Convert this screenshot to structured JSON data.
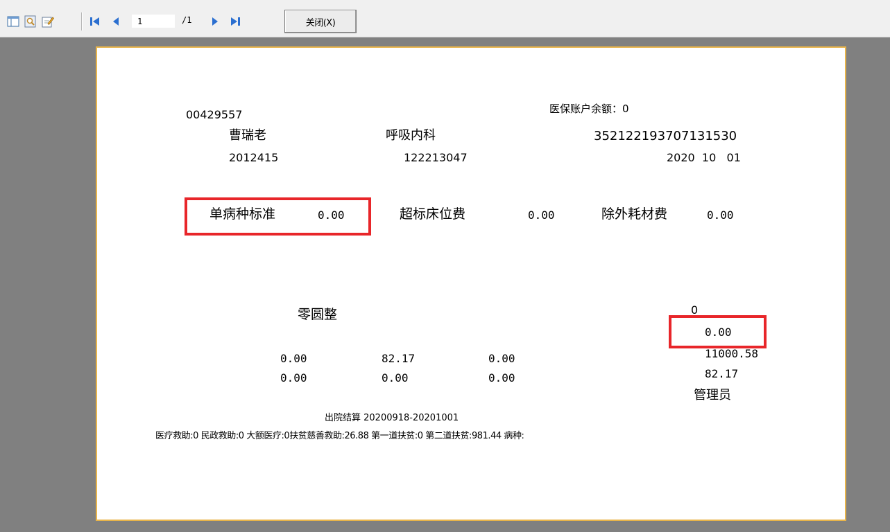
{
  "toolbar": {
    "page_current": "1",
    "page_total": "/1",
    "close_label": "关闭(X)"
  },
  "report": {
    "patient_id": "00429557",
    "account_balance": "医保账户余额：0",
    "name": "曹瑞老",
    "department": "呼吸内科",
    "id_number": "352122193707131530",
    "admission_no": "2012415",
    "insurance_no": "122213047",
    "date": "2020  10   01",
    "fees": {
      "single_disease_label": "单病种标准",
      "single_disease_value": "0.00",
      "over_bed_label": "超标床位费",
      "over_bed_value": "0.00",
      "excluded_material_label": "除外耗材费",
      "excluded_material_value": "0.00"
    },
    "amount_in_words": "零圆整",
    "right_values": [
      "0",
      "0.00",
      "11000.58",
      "82.17"
    ],
    "row1": [
      "0.00",
      "82.17",
      "0.00"
    ],
    "row2": [
      "0.00",
      "0.00",
      "0.00"
    ],
    "operator": "管理员",
    "settlement": "出院结算 20200918-20201001",
    "assistance": "医疗救助:0 民政救助:0 大额医疗:0扶贫慈善救助:26.88 第一道扶贫:0 第二道扶贫:981.44 病种:"
  },
  "colors": {
    "highlight": "#e8262a",
    "page_border": "#e8b44a"
  },
  "icons": [
    "layout-icon",
    "search-icon",
    "edit-icon",
    "first-page-icon",
    "prev-page-icon",
    "next-page-icon",
    "last-page-icon"
  ]
}
